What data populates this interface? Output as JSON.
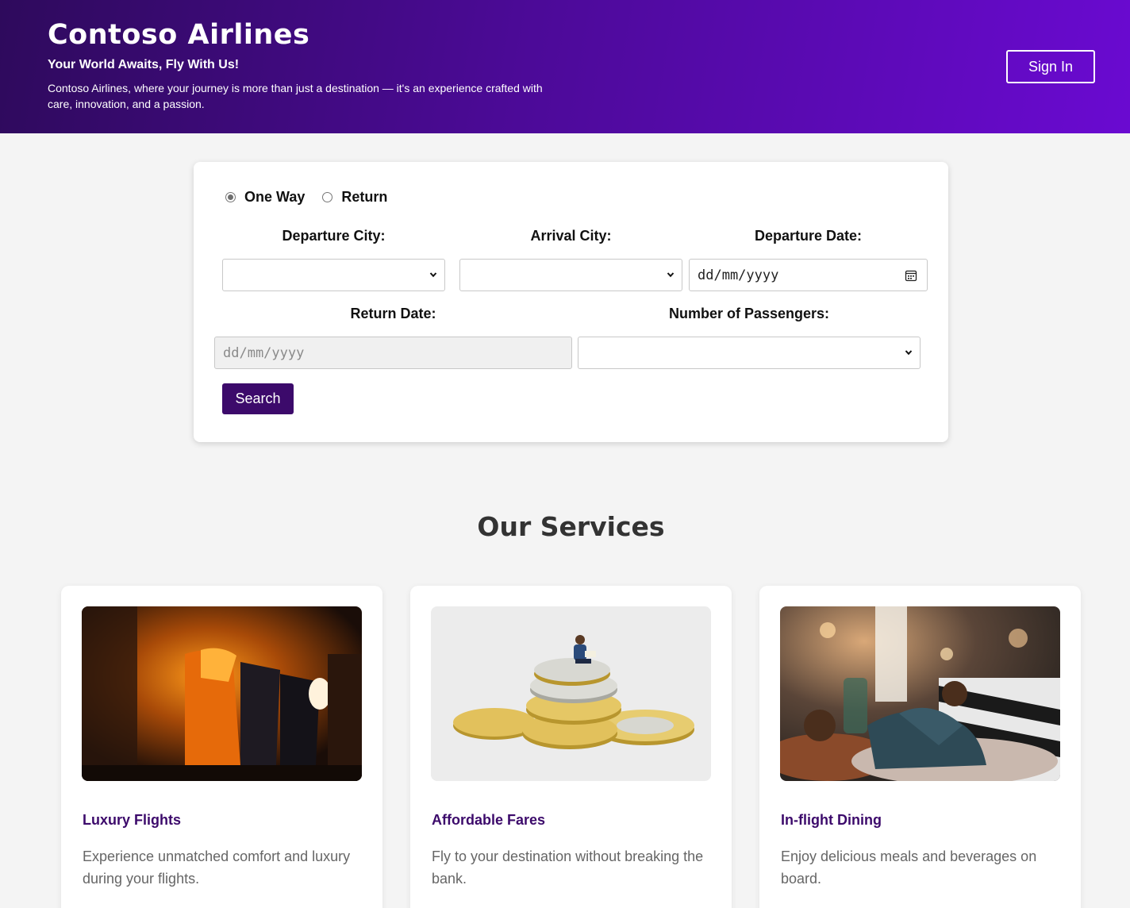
{
  "header": {
    "title": "Contoso Airlines",
    "tagline": "Your World Awaits, Fly With Us!",
    "description": "Contoso Airlines, where your journey is more than just a destination — it's an experience crafted with care, innovation, and a passion.",
    "signin_label": "Sign In"
  },
  "search": {
    "trip_types": [
      {
        "label": "One Way",
        "selected": true
      },
      {
        "label": "Return",
        "selected": false
      }
    ],
    "departure_city_label": "Departure City:",
    "arrival_city_label": "Arrival City:",
    "departure_date_label": "Departure Date:",
    "return_date_label": "Return Date:",
    "passengers_label": "Number of Passengers:",
    "departure_date_placeholder": "dd/mm/yyyy",
    "return_date_placeholder": "dd/mm/yyyy",
    "search_label": "Search"
  },
  "services": {
    "title": "Our Services",
    "items": [
      {
        "title": "Luxury Flights",
        "description": "Experience unmatched comfort and luxury during your flights.",
        "image": "airplane-cabin-photo"
      },
      {
        "title": "Affordable Fares",
        "description": "Fly to your destination without breaking the bank.",
        "image": "coins-stack-photo"
      },
      {
        "title": "In-flight Dining",
        "description": "Enjoy delicious meals and beverages on board.",
        "image": "dining-table-photo"
      }
    ]
  },
  "colors": {
    "header_gradient_start": "#2e0a5c",
    "header_gradient_end": "#6a0ad1",
    "accent": "#3c0a6b",
    "page_background": "#f4f4f4"
  }
}
